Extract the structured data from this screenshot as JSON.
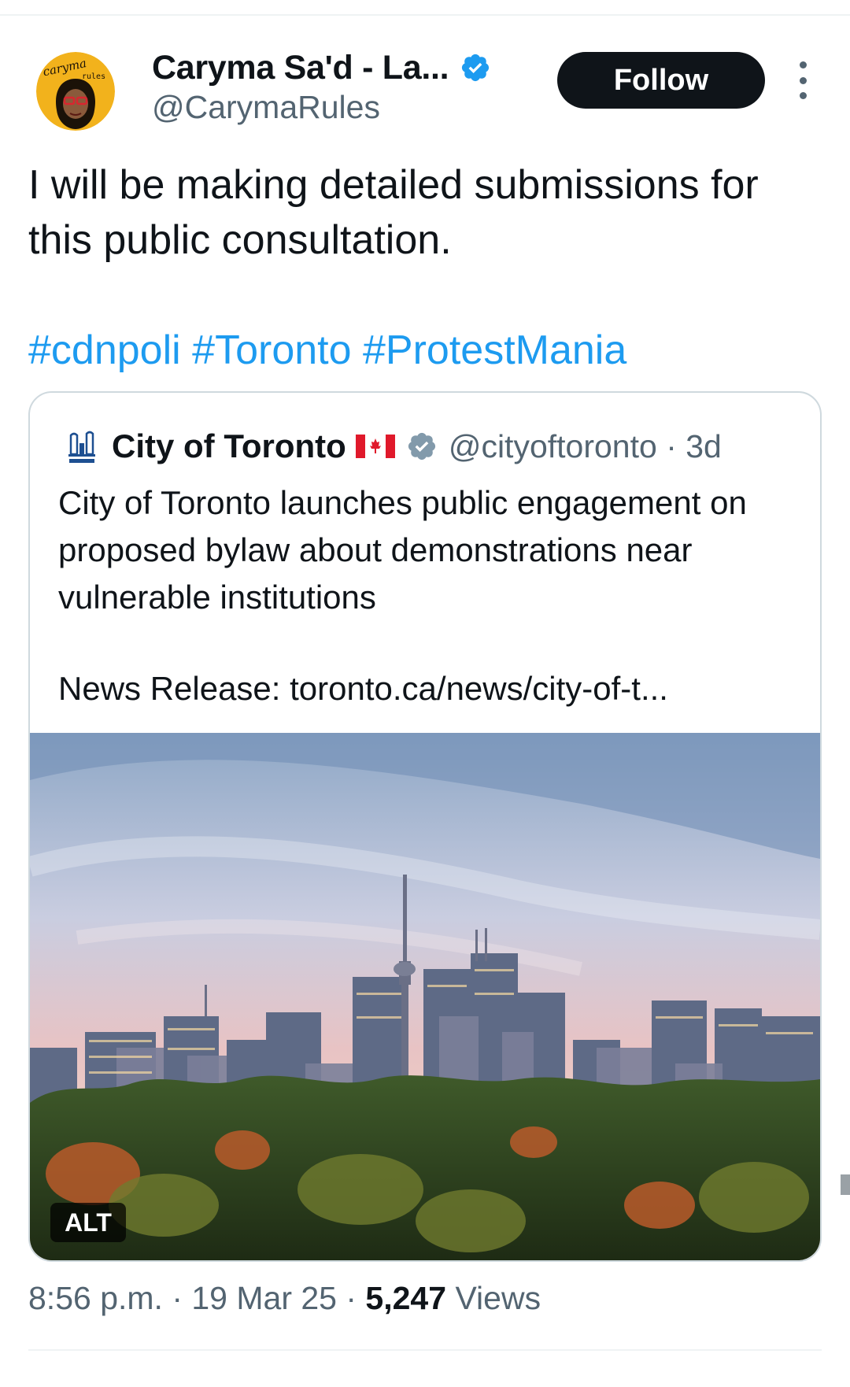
{
  "tweet": {
    "author": {
      "display_name": "Caryma Sa'd - La...",
      "handle": "@CarymaRules",
      "verified": true,
      "avatar_text": "caryma rules"
    },
    "follow_label": "Follow",
    "text": "I will be making detailed submissions for this public consultation.",
    "hashtags": [
      "#cdnpoli",
      "#Toronto",
      "#ProtestMania"
    ],
    "meta": {
      "time": "8:56 p.m.",
      "date": "19 Mar 25",
      "views_count": "5,247",
      "views_label": "Views"
    }
  },
  "quote": {
    "display_name": "City of Toronto",
    "handle": "@cityoftoronto",
    "age": "3d",
    "verified_grey": true,
    "text": "City of Toronto launches public engagement on proposed bylaw about demonstrations near vulnerable institutions",
    "link_line": "News Release: toronto.ca/news/city-of-t...",
    "image_alt_badge": "ALT"
  },
  "colors": {
    "link_blue": "#1d9bf0",
    "text": "#0f1419",
    "muted": "#536471",
    "border": "#cfd9de",
    "button_dark": "#0f1419"
  },
  "icons": [
    "avatar-image",
    "verified-badge-icon",
    "more-options-icon",
    "toronto-logo-icon",
    "canada-flag-icon",
    "grey-verified-icon"
  ]
}
